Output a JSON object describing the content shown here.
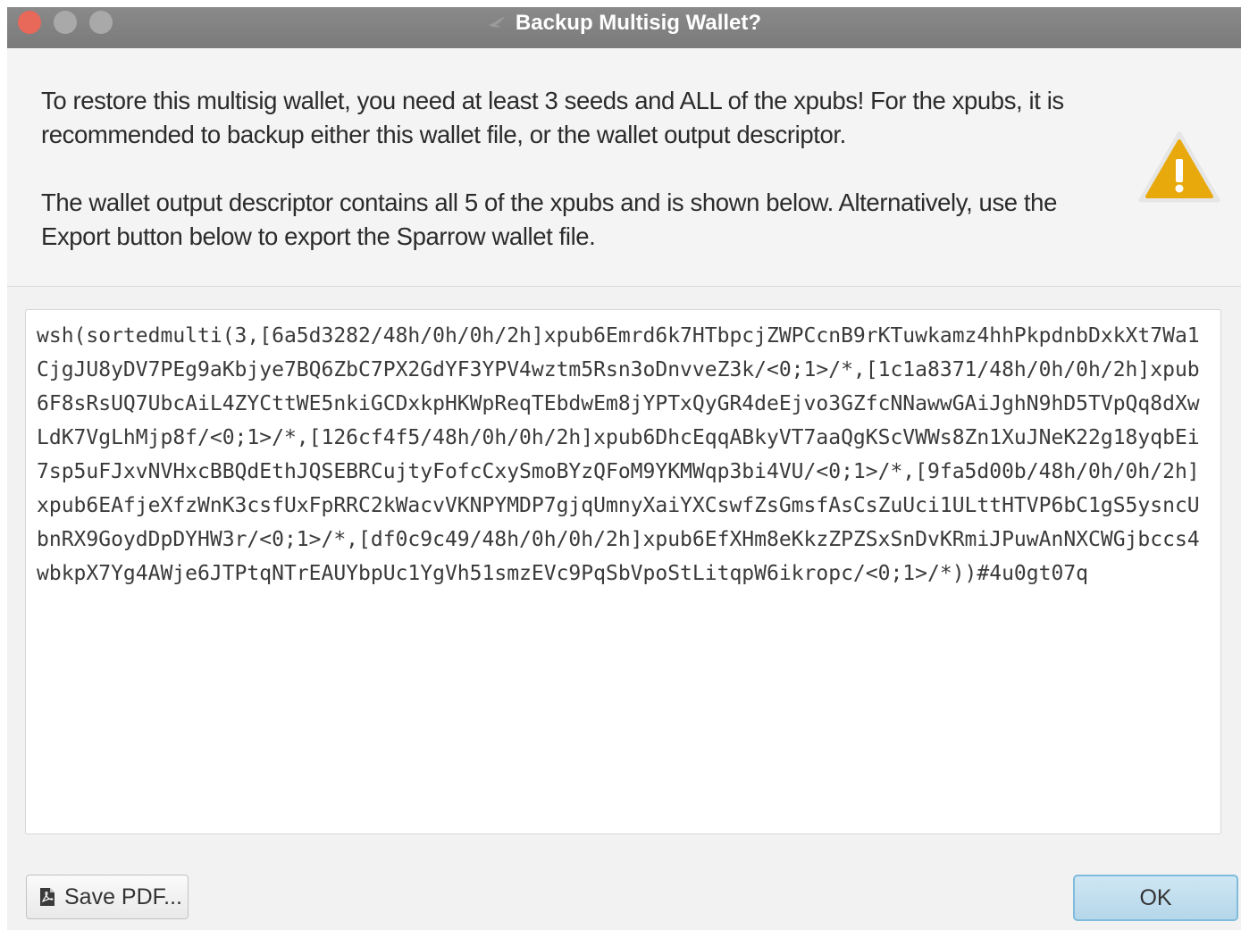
{
  "window": {
    "title": "Backup Multisig Wallet?"
  },
  "dialog": {
    "message_1": "To restore this multisig wallet, you need at least 3 seeds and ALL of the xpubs! For the xpubs, it is recommended to backup either this wallet file, or the wallet output descriptor.",
    "message_2": "The wallet output descriptor contains all 5 of the xpubs and is shown below. Alternatively, use the Export button below to export the Sparrow wallet file.",
    "icon": "warning-icon",
    "descriptor": "wsh(sortedmulti(3,[6a5d3282/48h/0h/0h/2h]xpub6Emrd6k7HTbpcjZWPCcnB9rKTuwkamz4hhPkpdnbDxkXt7Wa1CjgJU8yDV7PEg9aKbjye7BQ6ZbC7PX2GdYF3YPV4wztm5Rsn3oDnvveZ3k/<0;1>/*,[1c1a8371/48h/0h/0h/2h]xpub6F8sRsUQ7UbcAiL4ZYCttWE5nkiGCDxkpHKWpReqTEbdwEm8jYPTxQyGR4deEjvo3GZfcNNawwGAiJghN9hD5TVpQq8dXwLdK7VgLhMjp8f/<0;1>/*,[126cf4f5/48h/0h/0h/2h]xpub6DhcEqqABkyVT7aaQgKScVWWs8Zn1XuJNeK22g18yqbEi7sp5uFJxvNVHxcBBQdEthJQSEBRCujtyFofcCxySmoBYzQFoM9YKMWqp3bi4VU/<0;1>/*,[9fa5d00b/48h/0h/0h/2h]xpub6EAfjeXfzWnK3csfUxFpRRC2kWacvVKNPYMDP7gjqUmnyXaiYXCswfZsGmsfAsCsZuUci1ULttHTVP6bC1gS5ysncUbnRX9GoydDpDYHW3r/<0;1>/*,[df0c9c49/48h/0h/0h/2h]xpub6EfXHm8eKkzZPZSxSnDvKRmiJPuwAnNXCWGjbccs4wbkpX7Yg4AWje6JTPtqNTrEAUYbpUc1YgVh51smzEVc9PqSbVpoStLitqpW6ikropc/<0;1>/*))#4u0gt07q"
  },
  "buttons": {
    "save_pdf": "Save PDF...",
    "save_pdf_icon": "pdf-icon",
    "ok": "OK"
  },
  "colors": {
    "accent_ok": "#b5d7ea",
    "warning": "#e8a90d",
    "close_button": "#e8685a"
  }
}
